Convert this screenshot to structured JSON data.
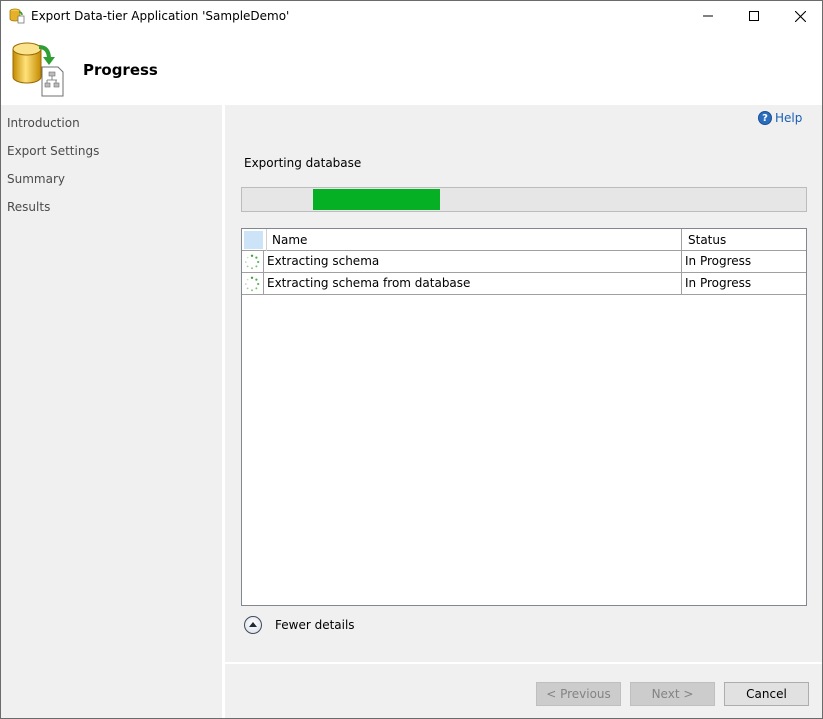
{
  "window": {
    "title": "Export Data-tier Application 'SampleDemo'",
    "icons": {
      "app": "database-export-icon",
      "minimize": "minimize-icon",
      "maximize": "maximize-icon",
      "close": "close-icon"
    }
  },
  "header": {
    "title": "Progress",
    "icon": "database-export-icon"
  },
  "sidebar": {
    "items": [
      {
        "label": "Introduction"
      },
      {
        "label": "Export Settings"
      },
      {
        "label": "Summary"
      },
      {
        "label": "Results"
      }
    ]
  },
  "content": {
    "help_label": "Help",
    "status_label": "Exporting database",
    "progress": {
      "type": "marquee",
      "segment_start": 0.125,
      "segment_end": 0.35,
      "color": "#06b025"
    },
    "grid": {
      "columns": {
        "name": "Name",
        "status": "Status"
      },
      "rows": [
        {
          "name": "Extracting schema",
          "status": "In Progress",
          "icon": "spinner-icon"
        },
        {
          "name": "Extracting schema from database",
          "status": "In Progress",
          "icon": "spinner-icon"
        }
      ]
    },
    "details_toggle": {
      "label": "Fewer details",
      "icon": "collapse-up-icon"
    }
  },
  "footer": {
    "previous_label": "< Previous",
    "next_label": "Next >",
    "cancel_label": "Cancel"
  },
  "colors": {
    "accent": "#06b025",
    "link": "#1a5fb4",
    "sidebar_bg": "#f0f0f0"
  }
}
